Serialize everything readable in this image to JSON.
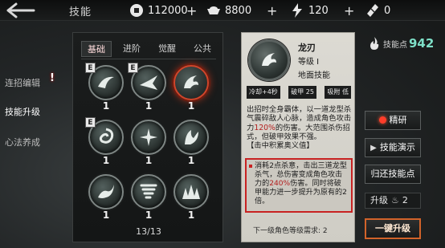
{
  "header": {
    "title": "技能",
    "resources": [
      {
        "icon": "silver-coin-icon",
        "value": "112000"
      },
      {
        "icon": "ingot-icon",
        "value": "8800"
      },
      {
        "icon": "lightning-icon",
        "value": "120"
      },
      {
        "icon": "ticket-icon",
        "value": "0"
      }
    ],
    "plus": "+"
  },
  "sidebar": {
    "items": [
      {
        "label": "连招编辑",
        "badge": "!"
      },
      {
        "label": "技能升级",
        "active": true
      },
      {
        "label": "心法养成"
      }
    ]
  },
  "skills_panel": {
    "tabs": [
      "基础",
      "进阶",
      "觉醒",
      "公共"
    ],
    "active_tab": "基础",
    "skills": [
      {
        "level": "1",
        "badge": "E",
        "icon": "wind-slash-icon"
      },
      {
        "level": "1",
        "badge": "E",
        "icon": "dash-strike-icon"
      },
      {
        "level": "1",
        "badge": "",
        "icon": "dragon-blade-icon",
        "selected": true
      },
      {
        "level": "1",
        "badge": "E",
        "icon": "whirlwind-icon"
      },
      {
        "level": "1",
        "badge": "",
        "icon": "shuriken-icon"
      },
      {
        "level": "1",
        "badge": "",
        "icon": "shadow-claw-icon"
      },
      {
        "level": "1",
        "badge": "",
        "icon": "rising-wave-icon"
      },
      {
        "level": "1",
        "badge": "",
        "icon": "tornado-icon"
      },
      {
        "level": "1",
        "badge": "",
        "icon": "shockwave-icon"
      }
    ],
    "page": "13/13"
  },
  "detail": {
    "name": "龙刃",
    "level": "等级 I",
    "type": "地面技能",
    "stats": {
      "cooldown": "冷却+4秒",
      "break": "破甲 25",
      "lifesteal": "吸附 低"
    },
    "desc_a": "出招时全身霸体，以一道龙型杀气震碎敌人心脉，造成角色攻击力",
    "desc_pct": "120%",
    "desc_b": "的伤害。大范围杀伤招式，但破甲效果不强。",
    "desc_tag": "【击中积累奥义值】",
    "upgrade_a": "消耗2点杀意，击出三道龙型杀气，总伤害变成角色攻击力的",
    "upgrade_pct": "240%",
    "upgrade_b": "伤害。同时将破甲能力进一步提升为原有的2倍。",
    "requirement": "下一级角色等级需求: 2"
  },
  "right_panel": {
    "points_label": "技能点",
    "points_value": "942",
    "refine": "精研",
    "demo": "技能演示",
    "return_points": "归还技能点",
    "upgrade_label": "升级",
    "upgrade_cost": "2",
    "one_key_upgrade": "一键升级"
  },
  "colors": {
    "accent_red": "#c82222",
    "points_teal": "#7ee0c8",
    "one_key_border": "#d2632a"
  }
}
